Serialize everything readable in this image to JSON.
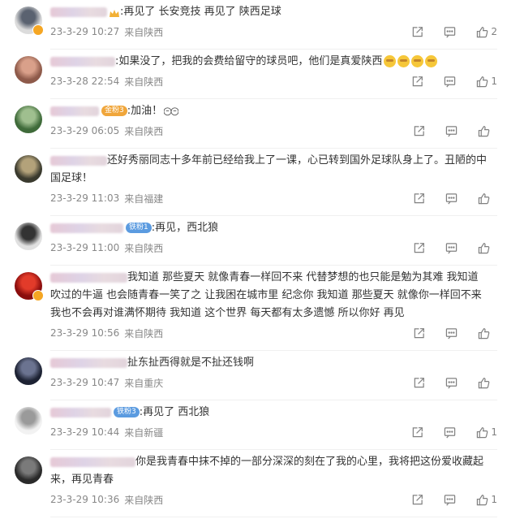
{
  "comments": [
    {
      "text": ":再见了 长安竞技 再见了 陕西足球",
      "time": "23-3-29 10:27",
      "location": "来自陕西",
      "likes": "2",
      "badge": "",
      "badge_color": "",
      "avatar_colors": [
        "#dcdcdc",
        "#5a6270"
      ]
    },
    {
      "text": ":如果没了，把我的会费给留守的球员吧，他们是真爱陕西",
      "time": "23-3-28 22:54",
      "location": "来自陕西",
      "likes": "1",
      "badge": "",
      "badge_color": "",
      "avatar_colors": [
        "#8e5a4a",
        "#d9a08a"
      ]
    },
    {
      "text": ":加油！",
      "time": "23-3-29 06:05",
      "location": "来自陕西",
      "likes": "",
      "badge": "金粉3",
      "badge_color": "#f0a63b",
      "avatar_colors": [
        "#3f6b3a",
        "#9fbf8f"
      ]
    },
    {
      "text": "还好秀丽同志十多年前已经给我上了一课，心已转到国外足球队身上了。丑陋的中国足球！",
      "time": "23-3-29 11:03",
      "location": "来自福建",
      "likes": "",
      "badge": "",
      "badge_color": "",
      "avatar_colors": [
        "#3a3a2e",
        "#b3a27a"
      ]
    },
    {
      "text": ":再见，西北狼",
      "time": "23-3-29 11:00",
      "location": "来自陕西",
      "likes": "",
      "badge": "铁粉1",
      "badge_color": "#5b9be0",
      "avatar_colors": [
        "#e0e0e0",
        "#333333"
      ]
    },
    {
      "text": "我知道 那些夏天 就像青春一样回不来 代替梦想的也只能是勉为其难 我知道 吹过的牛逼 也会随青春一笑了之 让我困在城市里 纪念你 我知道 那些夏天 就像你一样回不来 我也不会再对谁满怀期待 我知道 这个世界 每天都有太多遗憾 所以你好 再见",
      "time": "23-3-29 10:56",
      "location": "来自陕西",
      "likes": "",
      "badge": "",
      "badge_color": "",
      "avatar_colors": [
        "#8a0d0d",
        "#e23b2a"
      ]
    },
    {
      "text": "扯东扯西得就是不扯还钱啊",
      "time": "23-3-29 10:47",
      "location": "来自重庆",
      "likes": "",
      "badge": "",
      "badge_color": "",
      "avatar_colors": [
        "#1d2233",
        "#6b7390"
      ]
    },
    {
      "text": ":再见了 西北狼",
      "time": "23-3-29 10:44",
      "location": "来自新疆",
      "likes": "1",
      "badge": "铁粉3",
      "badge_color": "#5b9be0",
      "avatar_colors": [
        "#f2f2f2",
        "#9a9a9a"
      ]
    },
    {
      "text": "你是我青春中抹不掉的一部分深深的刻在了我的心里，我将把这份爱收藏起来，再见青春",
      "time": "23-3-29 10:36",
      "location": "来自陕西",
      "likes": "1",
      "badge": "",
      "badge_color": "",
      "avatar_colors": [
        "#2a2a2a",
        "#7a7a7a"
      ]
    }
  ],
  "icons": {
    "share": "share-icon",
    "reply": "comment-icon",
    "like": "thumb-up-icon"
  }
}
